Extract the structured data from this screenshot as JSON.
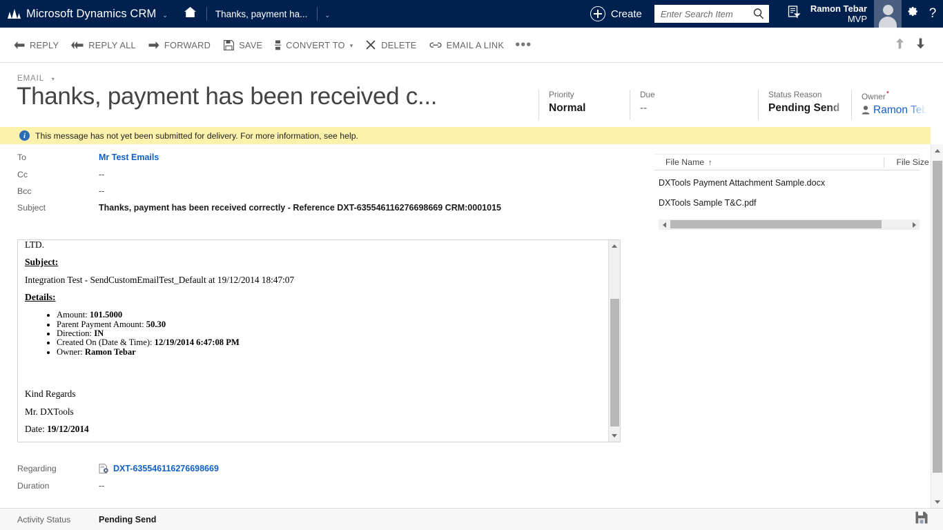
{
  "navbar": {
    "brand": "Microsoft Dynamics CRM",
    "brand_caret": "⌄",
    "home_icon": "home-icon",
    "record_tab": "Thanks, payment ha...",
    "record_caret": "⌄",
    "create_label": "Create",
    "search_placeholder": "Enter Search Item",
    "search_value": "",
    "advanced_find_icon": "advanced-find-icon",
    "user_name": "Ramon Tebar",
    "user_role": "MVP",
    "settings_icon": "gear-icon",
    "help_icon": "question-mark-icon",
    "help_label": "?"
  },
  "commandbar": {
    "buttons": [
      {
        "label": "REPLY",
        "icon": "reply-arrow-icon",
        "has_dropdown": false
      },
      {
        "label": "REPLY ALL",
        "icon": "reply-all-arrow-icon",
        "has_dropdown": false
      },
      {
        "label": "FORWARD",
        "icon": "forward-arrow-icon",
        "has_dropdown": false
      },
      {
        "label": "SAVE",
        "icon": "floppy-disk-icon",
        "has_dropdown": false
      },
      {
        "label": "CONVERT TO",
        "icon": "convert-to-icon",
        "has_dropdown": true
      },
      {
        "label": "DELETE",
        "icon": "x-delete-icon",
        "has_dropdown": false
      },
      {
        "label": "EMAIL A LINK",
        "icon": "link-chain-icon",
        "has_dropdown": false
      }
    ],
    "overflow_label": "•••",
    "prev_record_icon": "arrow-up-icon",
    "next_record_icon": "arrow-down-icon"
  },
  "record": {
    "entity_type": "EMAIL",
    "entity_caret": "▾",
    "title": "Thanks, payment has been received c...",
    "header_fields": [
      {
        "label": "Priority",
        "value": "Normal",
        "required": false,
        "style": "bold"
      },
      {
        "label": "Due",
        "value": "--",
        "required": false,
        "style": "dim"
      },
      {
        "label": "Status Reason",
        "value": "Pending Send",
        "required": false,
        "style": "bold"
      },
      {
        "label": "Owner",
        "value": "Ramon Tebar",
        "required": true,
        "style": "link",
        "icon": "person-icon"
      }
    ]
  },
  "notification": {
    "icon": "info-icon",
    "text": "This message has not yet been submitted for delivery. For more information, see help."
  },
  "email_fields": {
    "to_label": "To",
    "to_value": "Mr Test Emails",
    "cc_label": "Cc",
    "cc_value": "--",
    "bcc_label": "Bcc",
    "bcc_value": "--",
    "subject_label": "Subject",
    "subject_value": "Thanks, payment has been received correctly - Reference DXT-635546116276698669 CRM:0001015"
  },
  "email_body": {
    "clipped_top_line": "LTD.",
    "subject_heading": "Subject:",
    "subject_line": "Integration Test - SendCustomEmailTest_Default at 19/12/2014 18:47:07",
    "details_heading": "Details:",
    "details": [
      {
        "label": "Amount: ",
        "value": "101.5000"
      },
      {
        "label": "Parent Payment Amount: ",
        "value": "50.30"
      },
      {
        "label": "Direction: ",
        "value": "IN"
      },
      {
        "label": "Created On (Date & Time): ",
        "value": "12/19/2014 6:47:08 PM"
      },
      {
        "label": "Owner: ",
        "value": "Ramon Tebar"
      }
    ],
    "signoff": "Kind Regards",
    "sender": "Mr. DXTools",
    "date_label": "Date: ",
    "date_value": "19/12/2014"
  },
  "attachments": {
    "columns": [
      {
        "label": "File Name",
        "sort": "↑"
      },
      {
        "label": "File Size (Byt",
        "sort": ""
      }
    ],
    "rows": [
      {
        "file_name": "DXTools Payment Attachment Sample.docx",
        "file_size": ""
      },
      {
        "file_name": "DXTools Sample T&C.pdf",
        "file_size": ""
      }
    ]
  },
  "lower_fields": {
    "regarding_label": "Regarding",
    "regarding_value": "DXT-635546116276698669",
    "regarding_icon": "record-lookup-icon",
    "duration_label": "Duration",
    "duration_value": "--"
  },
  "footer": {
    "activity_status_label": "Activity Status",
    "activity_status_value": "Pending Send",
    "save_icon": "floppy-disk-icon"
  },
  "colors": {
    "nav_background": "#002050",
    "notification_background": "#fdf2ab",
    "link": "#1160c4",
    "required_asterisk": "#c8102e",
    "title_text": "#444444"
  }
}
